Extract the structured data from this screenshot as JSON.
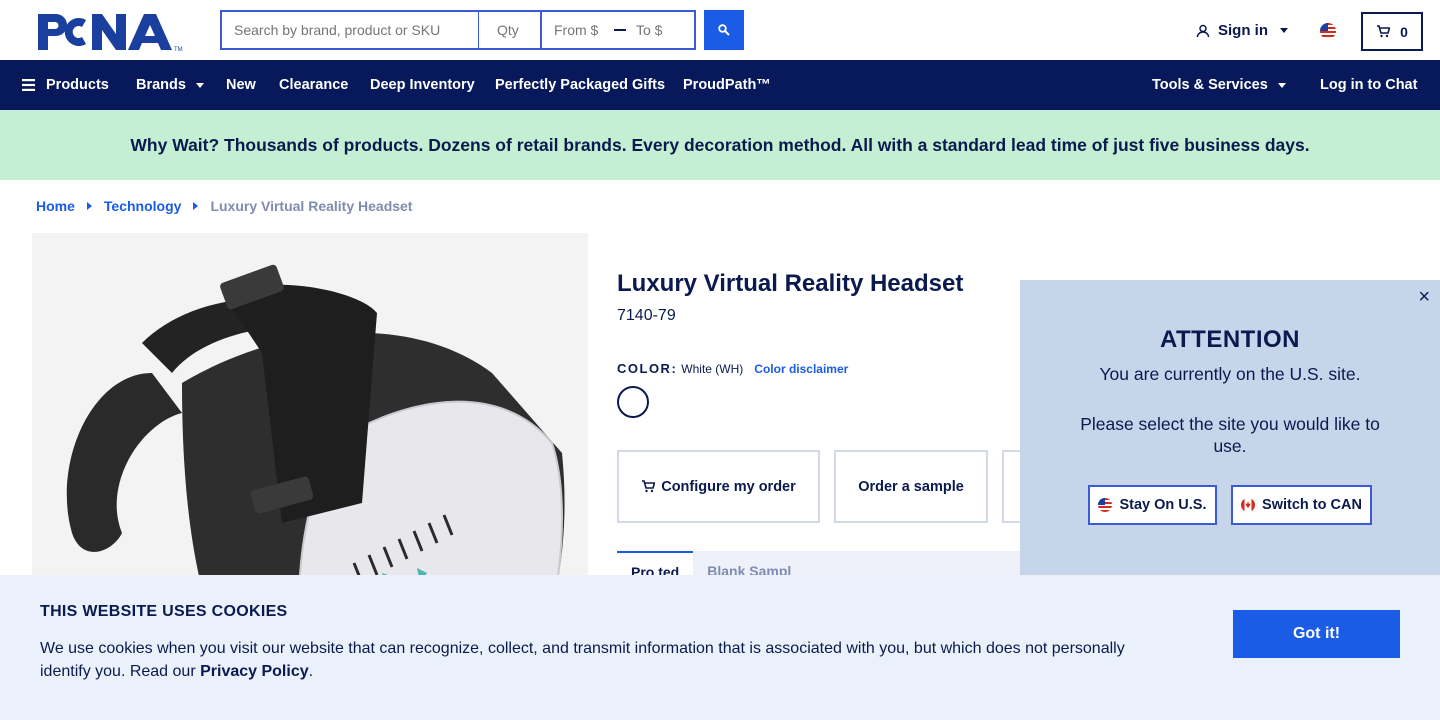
{
  "header": {
    "logo_text": "PCNA",
    "search_placeholder": "Search by brand, product or SKU",
    "qty_placeholder": "Qty",
    "price_from_placeholder": "From $",
    "price_to_placeholder": "To $",
    "signin_label": "Sign in",
    "cart_count": "0"
  },
  "nav": {
    "products": "Products",
    "brands": "Brands",
    "new": "New",
    "clearance": "Clearance",
    "deep_inventory": "Deep Inventory",
    "gifts": "Perfectly Packaged Gifts",
    "proudpath": "ProudPath™",
    "tools": "Tools & Services",
    "chat": "Log in to Chat"
  },
  "promo": {
    "text": "Why Wait? Thousands of products. Dozens of retail brands. Every decoration method. All with a standard lead time of just five business days."
  },
  "breadcrumb": {
    "home": "Home",
    "category": "Technology",
    "current": "Luxury Virtual Reality Headset"
  },
  "product": {
    "title": "Luxury Virtual Reality Headset",
    "sku": "7140-79",
    "color_label": "COLOR:",
    "color_value": "White (WH)",
    "color_disclaimer": "Color disclaimer",
    "configure_label": "Configure my order",
    "sample_label": "Order a sample",
    "tabs": [
      {
        "label": "Pro  ted"
      },
      {
        "label": "Blank  Sampl"
      }
    ]
  },
  "modal": {
    "heading": "ATTENTION",
    "text1": "You are currently on the U.S. site.",
    "text2": "Please select the site you would like to use.",
    "stay_label": "Stay On U.S.",
    "switch_label": "Switch to CAN",
    "close_symbol": "×"
  },
  "cookie": {
    "title": "THIS WEBSITE USES COOKIES",
    "text": "We use cookies when you visit our website that can recognize, collect, and transmit information that is associated with you, but which does not personally identify you. Read our ",
    "link": "Privacy Policy",
    "end": ".",
    "button": "Got it!"
  },
  "colors": {
    "navy": "#07195a",
    "accent_blue": "#1a5ce6",
    "promo_green": "#c5efd2",
    "modal_bg": "#c6d5ea",
    "cookie_bg": "#ebf1fb"
  }
}
